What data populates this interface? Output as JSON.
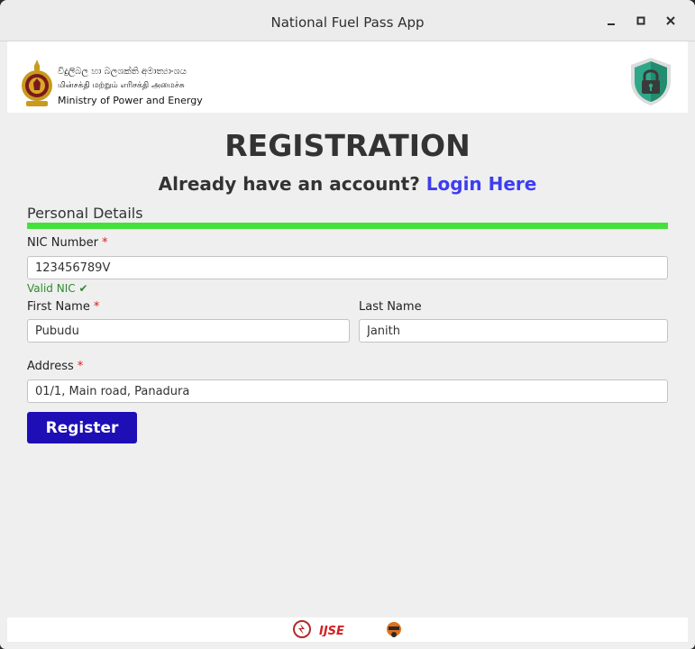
{
  "window": {
    "title": "National Fuel Pass App",
    "controls": [
      "minimize-icon",
      "maximize-icon",
      "close-icon"
    ]
  },
  "header": {
    "ministry_sinhala": "විදුලිබල හා බලශක්ති අමාත්‍යාංශය",
    "ministry_tamil": "மின்சக்தி மற்றும் எரிசக்தி அமைச்சு",
    "ministry_english": "Ministry of Power and Energy",
    "emblem_icon": "sri-lanka-emblem-icon",
    "security_icon": "shield-lock-icon"
  },
  "form": {
    "heading": "REGISTRATION",
    "account_prompt": "Already have an account?",
    "login_link": "Login Here",
    "section_title": "Personal Details",
    "progress": 1.0,
    "progress_color": "#44e13b",
    "nic": {
      "label": "NIC Number",
      "required": "*",
      "value": "123456789V",
      "validation": "Valid NIC ✔"
    },
    "first_name": {
      "label": "First Name",
      "required": "*",
      "value": "Pubudu"
    },
    "last_name": {
      "label": "Last Name",
      "value": "Janith"
    },
    "address": {
      "label": "Address",
      "required": "*",
      "value": "01/1, Main road, Panadura"
    },
    "register_button": "Register",
    "accent_color": "#1d0fb5",
    "link_color": "#3d3df0"
  },
  "footer": {
    "logos": [
      "fuel-pass-logo-icon",
      "ijse-logo-icon",
      "mascot-logo-icon"
    ],
    "ijse_text": "IJSE"
  }
}
